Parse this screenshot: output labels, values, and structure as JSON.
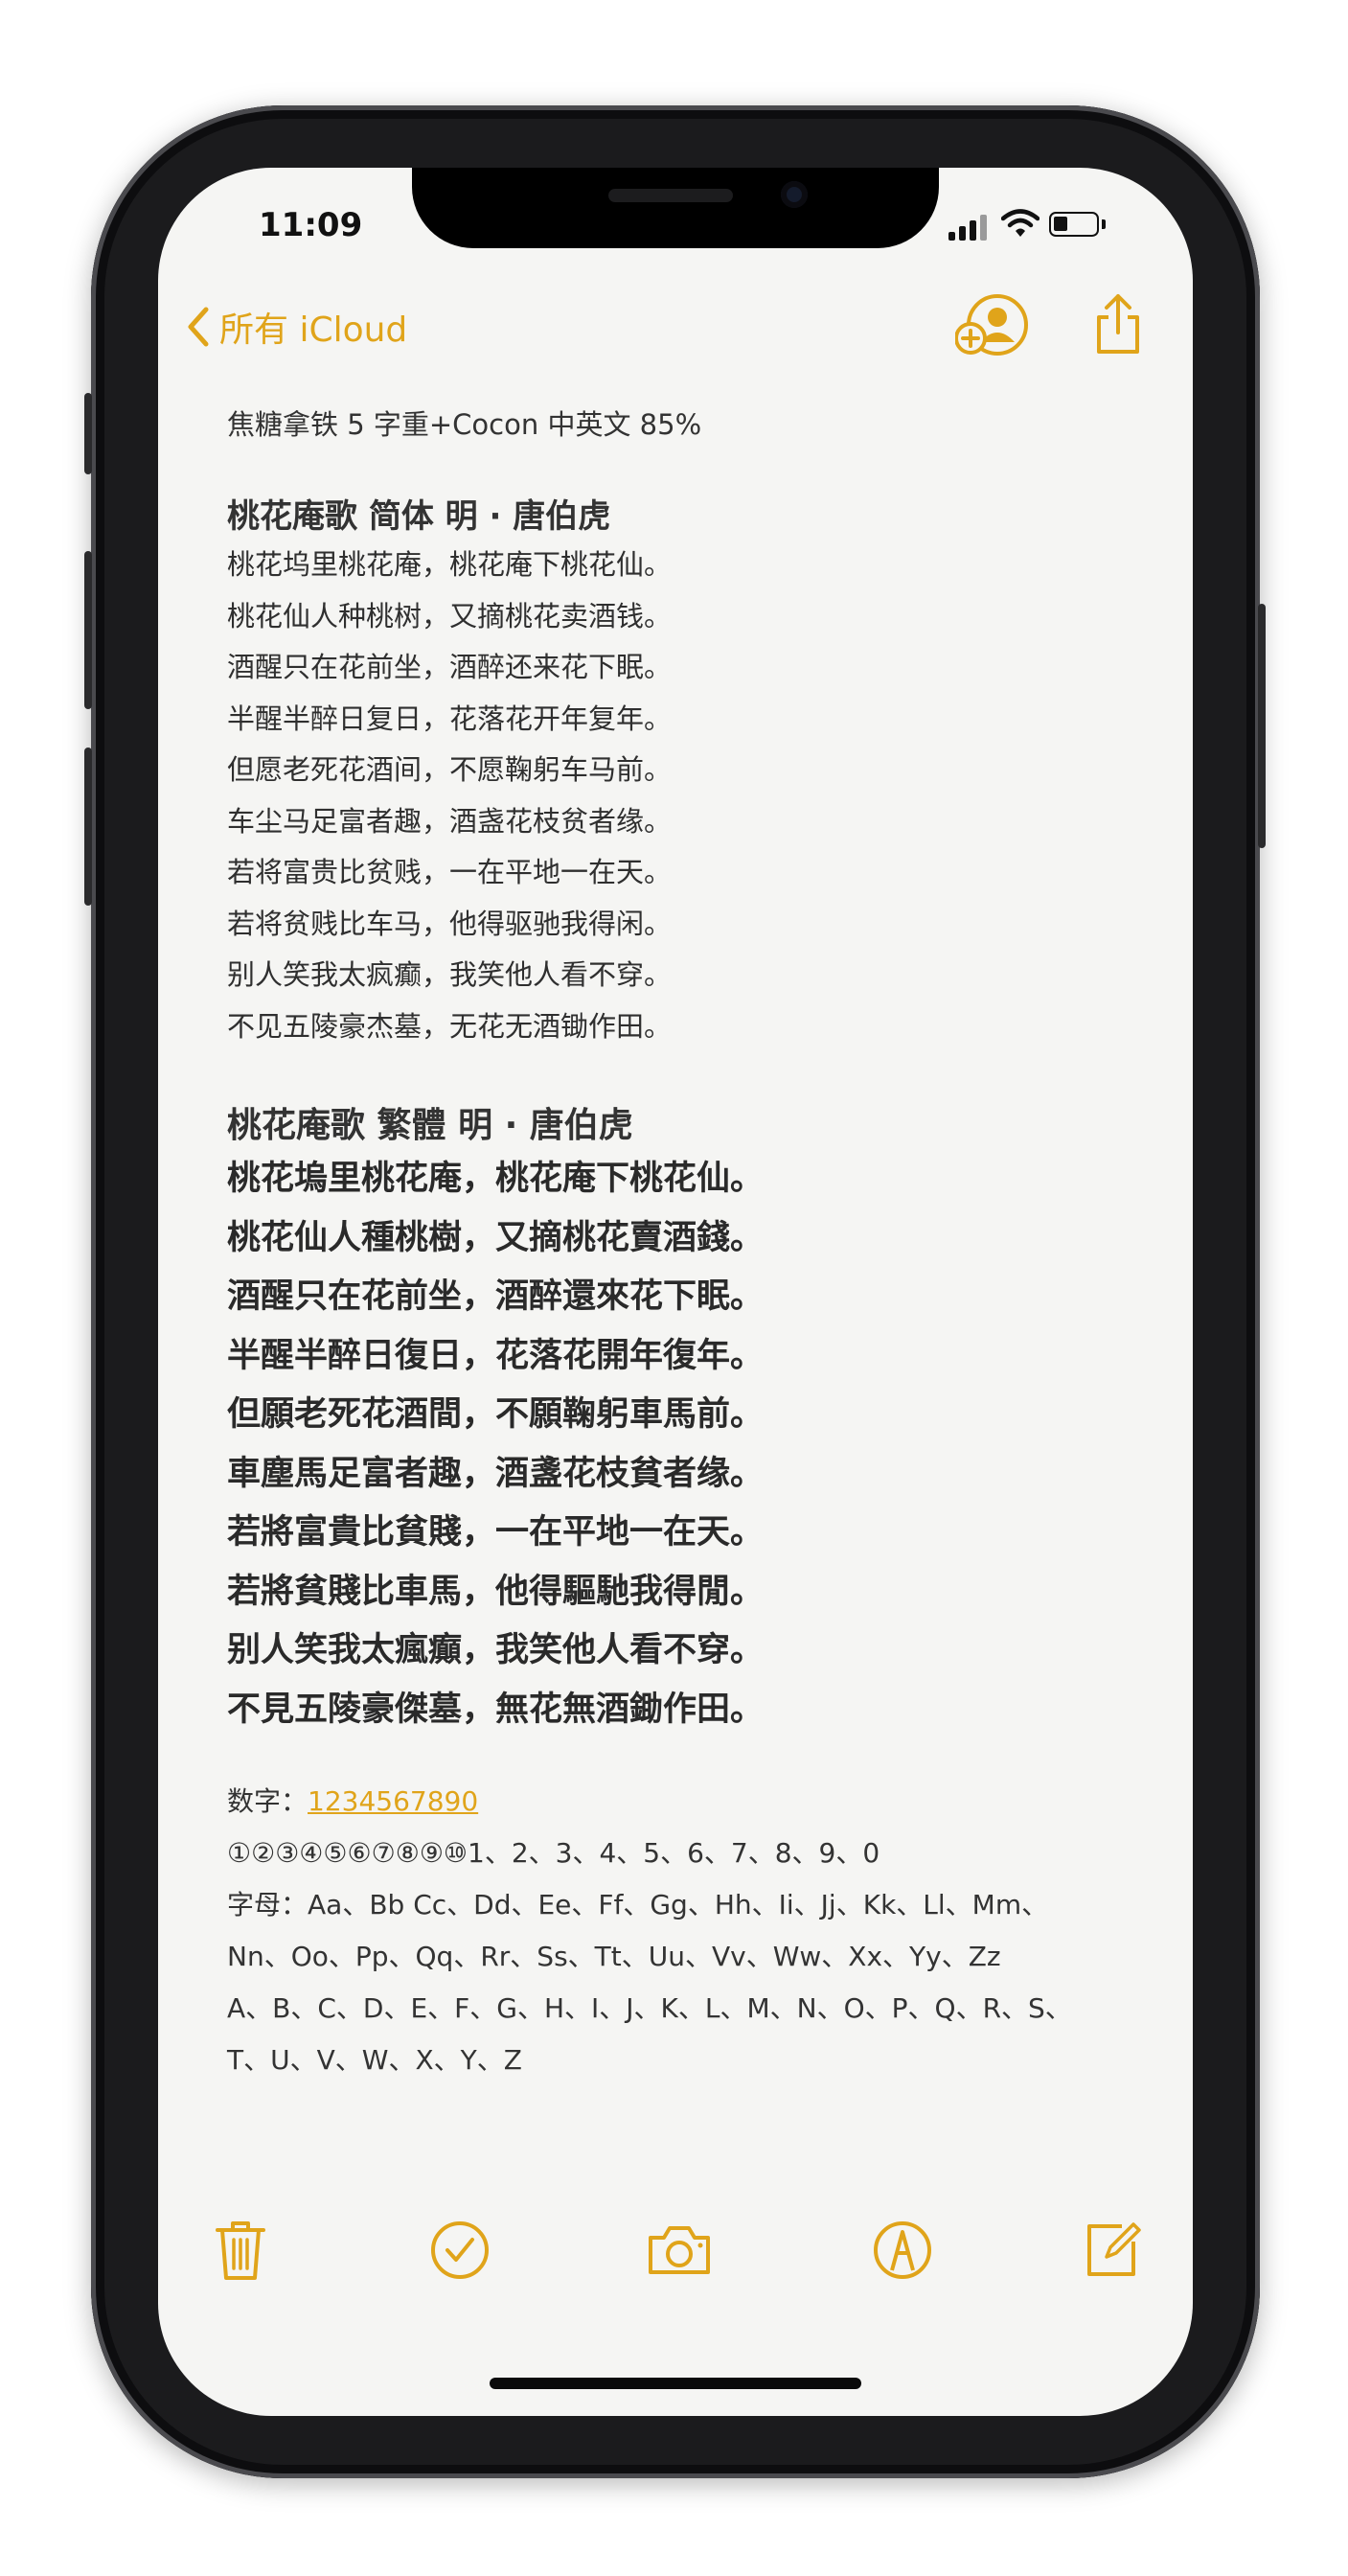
{
  "status": {
    "time": "11:09"
  },
  "nav": {
    "back_label": "所有 iCloud"
  },
  "note": {
    "font_line": "焦糖拿铁 5 字重+Cocon 中英文 85%",
    "simplified": {
      "title": "桃花庵歌  简体   明 · 唐伯虎",
      "lines": [
        "桃花坞里桃花庵，桃花庵下桃花仙。",
        "桃花仙人种桃树，又摘桃花卖酒钱。",
        "酒醒只在花前坐，酒醉还来花下眠。",
        "半醒半醉日复日，花落花开年复年。",
        "但愿老死花酒间，不愿鞠躬车马前。",
        "车尘马足富者趣，酒盏花枝贫者缘。",
        "若将富贵比贫贱，一在平地一在天。",
        "若将贫贱比车马，他得驱驰我得闲。",
        "别人笑我太疯癫，我笑他人看不穿。",
        "不见五陵豪杰墓，无花无酒锄作田。"
      ]
    },
    "traditional": {
      "title": "桃花庵歌  繁體     明 · 唐伯虎",
      "lines": [
        "桃花塢里桃花庵，桃花庵下桃花仙。",
        "桃花仙人種桃樹，又摘桃花賣酒錢。",
        "酒醒只在花前坐，酒醉還來花下眠。",
        "半醒半醉日復日，花落花開年復年。",
        "但願老死花酒間，不願鞠躬車馬前。",
        "車塵馬足富者趣，酒盞花枝貧者缘。",
        "若將富貴比貧賤，一在平地一在天。",
        "若將貧賤比車馬，他得驅馳我得閒。",
        "别人笑我太瘋癲，我笑他人看不穿。",
        "不見五陵豪傑墓，無花無酒鋤作田。"
      ]
    },
    "digits_label": "数字：",
    "digits_value": "1234567890",
    "circled_line": "①②③④⑤⑥⑦⑧⑨⑩1、2、3、4、5、6、7、8、9、0",
    "letters_line1": "字母：Aa、Bb Cc、Dd、Ee、Ff、Gg、Hh、Ii、Jj、Kk、Ll、Mm、",
    "letters_line2": "Nn、Oo、Pp、Qq、Rr、Ss、Tt、Uu、Vv、Ww、Xx、Yy、Zz",
    "letters_line3": "A、B、C、D、E、F、G、H、I、J、K、L、M、N、O、P、Q、R、S、",
    "letters_line4": "T、U、V、W、X、Y、Z"
  },
  "colors": {
    "accent": "#e0a41a",
    "paper": "#f5f5f3",
    "text": "#333333"
  },
  "icons": {
    "back": "chevron-left-icon",
    "share_person": "add-person-icon",
    "share": "share-icon",
    "trash": "trash-icon",
    "checklist": "checkmark-circle-icon",
    "camera": "camera-icon",
    "markup": "markup-pen-icon",
    "compose": "compose-icon"
  }
}
